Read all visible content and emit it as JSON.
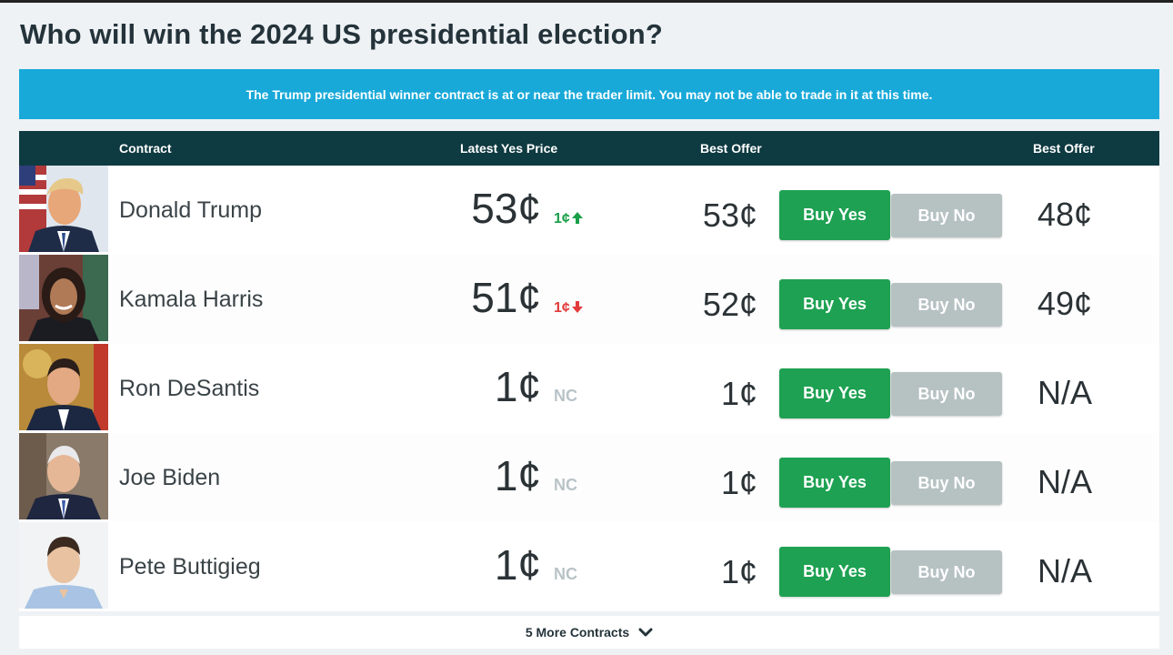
{
  "page": {
    "title": "Who will win the 2024 US presidential election?"
  },
  "notice": {
    "text": "The Trump presidential winner contract is at or near the trader limit. You may not be able to trade in it at this time."
  },
  "table": {
    "headers": {
      "contract": "Contract",
      "latest_yes_price": "Latest Yes Price",
      "best_offer_yes": "Best Offer",
      "best_offer_no": "Best Offer"
    },
    "rows": [
      {
        "name": "Donald Trump",
        "latest": "53¢",
        "change": "1¢",
        "change_dir": "up",
        "best_yes": "53¢",
        "buy_yes": "Buy Yes",
        "buy_no": "Buy No",
        "best_no": "48¢"
      },
      {
        "name": "Kamala Harris",
        "latest": "51¢",
        "change": "1¢",
        "change_dir": "down",
        "best_yes": "52¢",
        "buy_yes": "Buy Yes",
        "buy_no": "Buy No",
        "best_no": "49¢"
      },
      {
        "name": "Ron DeSantis",
        "latest": "1¢",
        "change": "NC",
        "change_dir": "none",
        "best_yes": "1¢",
        "buy_yes": "Buy Yes",
        "buy_no": "Buy No",
        "best_no": "N/A"
      },
      {
        "name": "Joe Biden",
        "latest": "1¢",
        "change": "NC",
        "change_dir": "none",
        "best_yes": "1¢",
        "buy_yes": "Buy Yes",
        "buy_no": "Buy No",
        "best_no": "N/A"
      },
      {
        "name": "Pete Buttigieg",
        "latest": "1¢",
        "change": "NC",
        "change_dir": "none",
        "best_yes": "1¢",
        "buy_yes": "Buy Yes",
        "buy_no": "Buy No",
        "best_no": "N/A"
      }
    ]
  },
  "more_contracts": {
    "label": "5 More Contracts",
    "icon": "chevron-down-icon"
  },
  "colors": {
    "notice_bg": "#18a9d9",
    "header_bg": "#0e3a41",
    "buy_yes": "#1ea152",
    "buy_no": "#b6c1c2",
    "up": "#1a9e48",
    "down": "#e23b3b",
    "nc": "#b9c3c7"
  }
}
